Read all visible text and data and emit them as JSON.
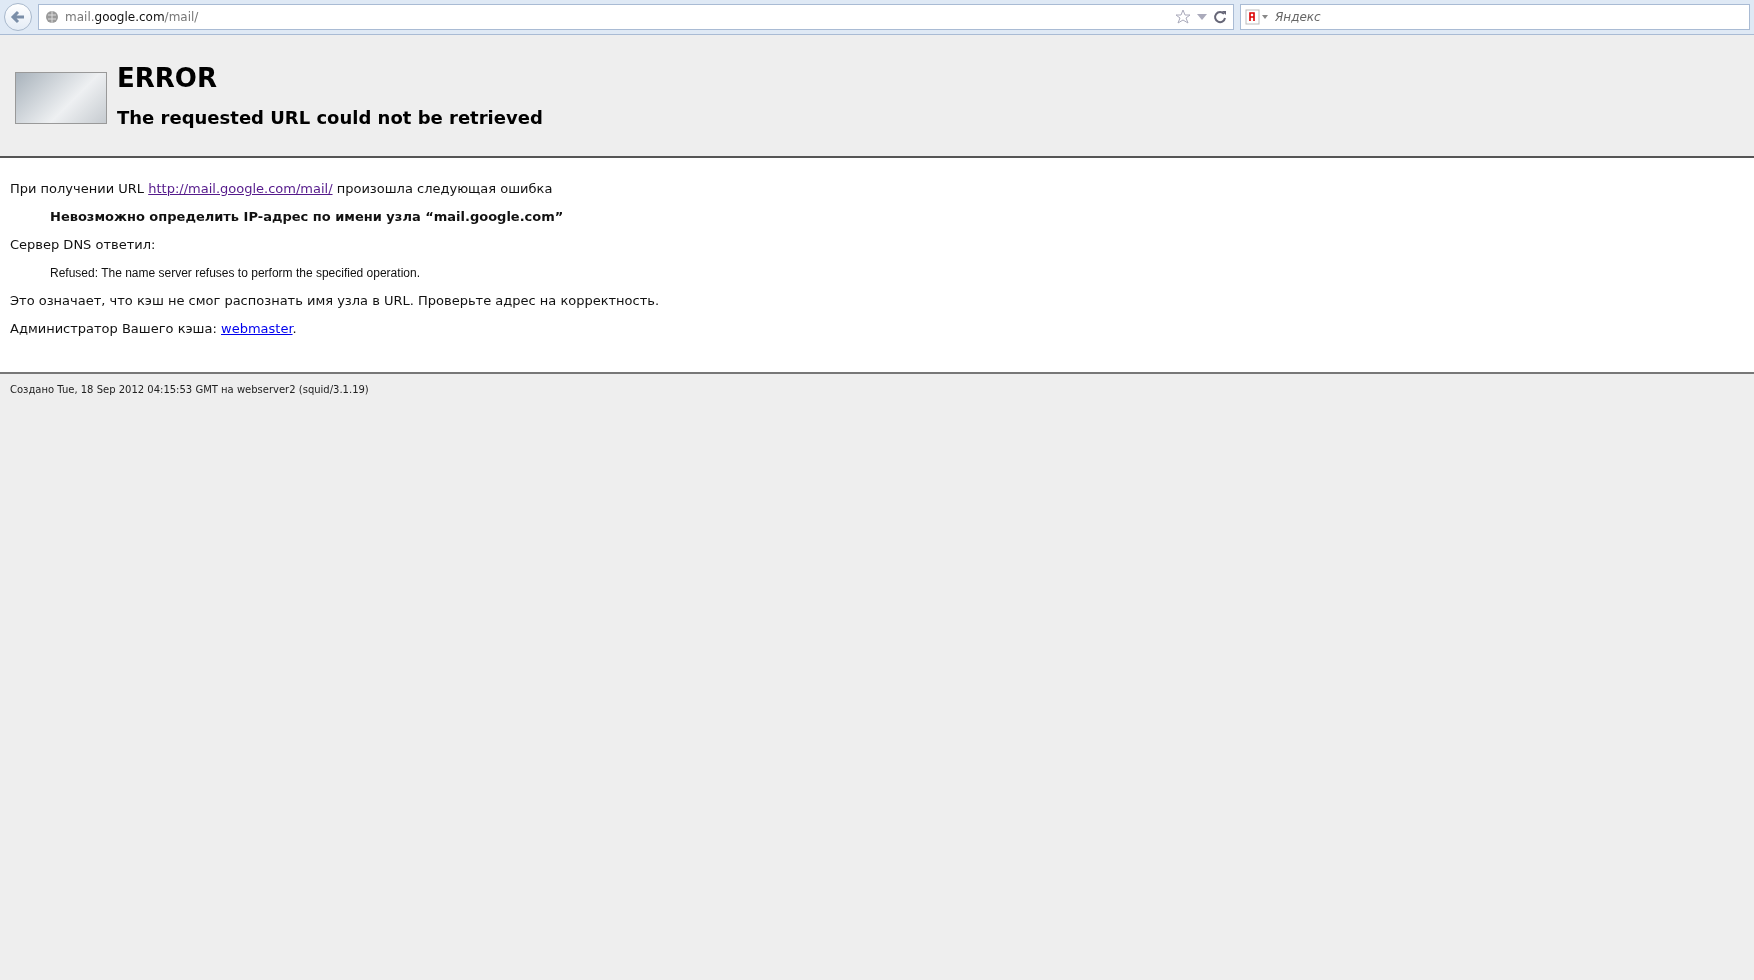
{
  "browser": {
    "url": "mail.**google.com**/mail/",
    "search_placeholder": "Яндекс"
  },
  "header": {
    "title": "ERROR",
    "subtitle": "The requested URL could not be retrieved"
  },
  "body": [
    {
      "kind": "link-paragraph",
      "before": "При получении URL ",
      "link": "http://mail.google.com/mail/",
      "after": " произошла следующая ошибка",
      "visited": true
    },
    {
      "kind": "error",
      "text": "Невозможно определить IP-адрес по имени узла “mail.google.com”"
    },
    {
      "kind": "paragraph",
      "text": "Сервер DNS ответил:"
    },
    {
      "kind": "detail",
      "text": "Refused: The name server refuses to perform the specified operation."
    },
    {
      "kind": "paragraph",
      "text": "Это означает, что кэш не смог распознать имя узла в URL. Проверьте адрес на корректность."
    },
    {
      "kind": "link-paragraph",
      "before": "Администратор Вашего кэша: ",
      "link": "webmaster",
      "after": ".",
      "visited": false
    }
  ],
  "footer": "Создано Tue, 18 Sep 2012 04:15:53 GMT на webserver2 (squid/3.1.19)"
}
